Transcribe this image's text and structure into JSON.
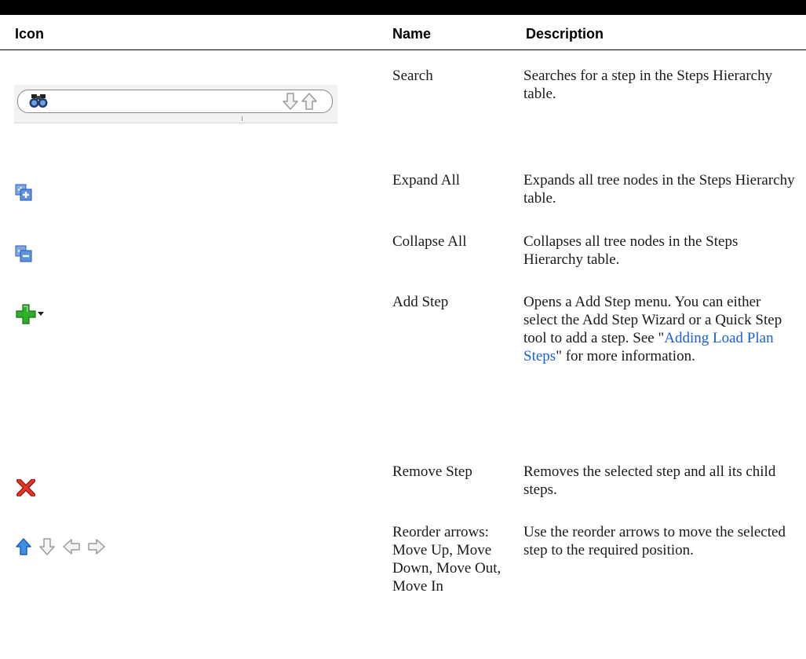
{
  "table": {
    "headers": {
      "icon": "Icon",
      "name": "Name",
      "description": "Description"
    },
    "rows": [
      {
        "icon": "search-toolbar-icon",
        "name": "Search",
        "description": "Searches for a step in the Steps Hierarchy table."
      },
      {
        "icon": "expand-all-icon",
        "name": "Expand All",
        "description": "Expands all tree nodes in the Steps Hierarchy table."
      },
      {
        "icon": "collapse-all-icon",
        "name": "Collapse All",
        "description": "Collapses all tree nodes in the Steps Hierarchy table."
      },
      {
        "icon": "add-step-icon",
        "name": "Add Step",
        "description_pre": "Opens a Add Step menu. You can either select the Add Step Wizard or a Quick Step tool to add a step. See \"",
        "description_link": "Adding Load Plan Steps",
        "description_post": "\" for more information."
      },
      {
        "icon": "remove-step-icon",
        "name": "Remove Step",
        "description": "Removes the selected step and all its child steps."
      },
      {
        "icon": "reorder-arrows-icon",
        "name": "Reorder arrows: Move Up, Move Down, Move Out, Move In",
        "description": "Use the reorder arrows to move the selected step to the required position."
      }
    ]
  },
  "colors": {
    "link": "#1a5fd6",
    "header_bar": "#000000"
  }
}
